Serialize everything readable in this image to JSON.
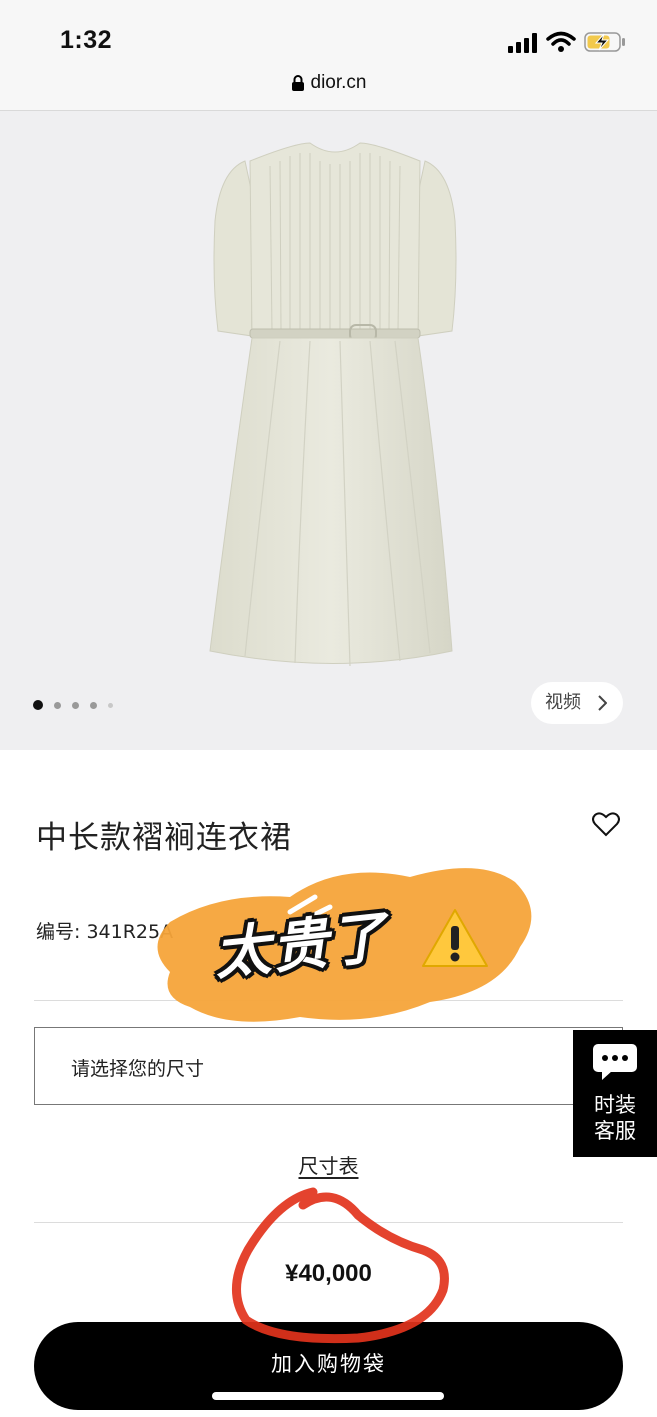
{
  "status_bar": {
    "time": "1:32",
    "url": "dior.cn"
  },
  "gallery": {
    "dot_count": 5,
    "active_dot": 0,
    "video_label": "视频"
  },
  "product": {
    "title": "中长款褶裥连衣裙",
    "code": "编号: 341R25A",
    "size_placeholder": "请选择您的尺寸",
    "size_chart_label": "尺寸表",
    "price": "¥40,000",
    "add_to_cart_label": "加入购物袋"
  },
  "service": {
    "line1": "时装",
    "line2": "客服"
  },
  "overlay": {
    "sticker_text": "太贵了"
  },
  "colors": {
    "sticker_orange": "#f5a43a",
    "annotation_red": "#e2331c",
    "warning_yellow": "#ffc83d"
  },
  "icons": {
    "lock": "lock-icon",
    "heart": "heart-icon",
    "chevron": "chevron-right-icon",
    "chat": "chat-bubble-icon",
    "warning": "warning-icon"
  }
}
